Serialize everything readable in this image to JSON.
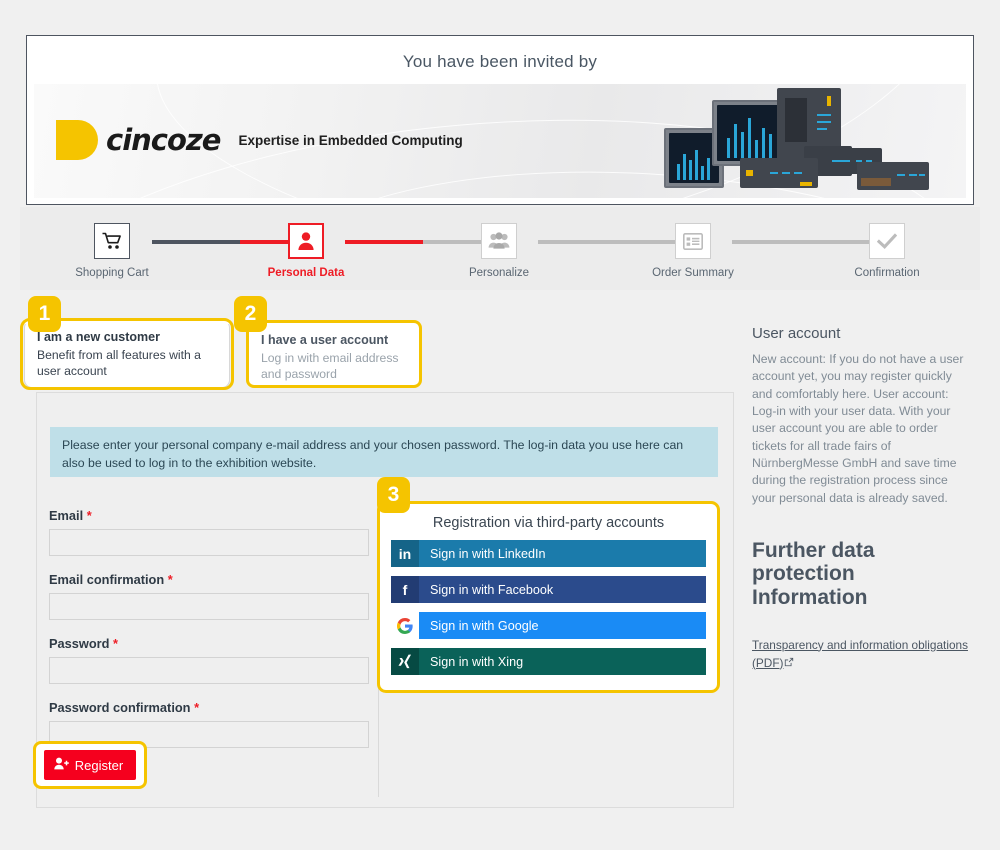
{
  "invited": {
    "title": "You have been invited by",
    "banner": {
      "logo_text": "cincoze",
      "tagline": "Expertise in Embedded Computing",
      "logo_color": "#f5c400"
    }
  },
  "stepper": {
    "steps": [
      {
        "label": "Shopping Cart",
        "icon": "shopping-cart-icon",
        "state": "done"
      },
      {
        "label": "Personal Data",
        "icon": "person-icon",
        "state": "active"
      },
      {
        "label": "Personalize",
        "icon": "people-group-icon",
        "state": "upcoming"
      },
      {
        "label": "Order Summary",
        "icon": "list-document-icon",
        "state": "upcoming"
      },
      {
        "label": "Confirmation",
        "icon": "check-icon",
        "state": "upcoming"
      }
    ],
    "active_color": "#ee1c25",
    "done_color": "#4e5560",
    "upcoming_color": "#c0c0c0"
  },
  "tabs": [
    {
      "badge": "1",
      "title": "I am a new customer",
      "subtitle": "Benefit from all features with a user account",
      "selected": true
    },
    {
      "badge": "2",
      "title": "I have a user account",
      "subtitle": "Log in with email address and password",
      "selected": false
    }
  ],
  "main": {
    "notice": "Please enter your personal company e-mail address and your chosen password. The log-in data you use here can also be used to log in to the exhibition website.",
    "form": {
      "fields": [
        {
          "label": "Email",
          "required": "*",
          "value": "",
          "placeholder": ""
        },
        {
          "label": "Email confirmation",
          "required": "*",
          "value": "",
          "placeholder": ""
        },
        {
          "label": "Password",
          "required": "*",
          "value": "",
          "placeholder": ""
        },
        {
          "label": "Password confirmation",
          "required": "*",
          "value": "",
          "placeholder": ""
        }
      ],
      "register_label": "Register",
      "register_icon": "user-add-icon",
      "register_color": "#f5001e"
    },
    "third_party": {
      "badge": "3",
      "title": "Registration via third-party accounts",
      "buttons": [
        {
          "label": "Sign in with LinkedIn",
          "icon": "linkedin-icon",
          "glyph": "in",
          "color": "#1b7bab"
        },
        {
          "label": "Sign in with Facebook",
          "icon": "facebook-icon",
          "glyph": "f",
          "color": "#2b4b8c"
        },
        {
          "label": "Sign in with Google",
          "icon": "google-icon",
          "glyph": "G",
          "color": "#1a8bf5"
        },
        {
          "label": "Sign in with Xing",
          "icon": "xing-icon",
          "glyph": "X",
          "color": "#0a6259"
        }
      ]
    }
  },
  "sidebar": {
    "heading": "User account",
    "paragraph": "New account: If you do not have a user account yet, you may register quickly and comfortably here.\nUser account: Log-in with your user data. With your user account you are able to order tickets for all trade fairs of NürnbergMesse GmbH and save time during the registration process since your personal data is already saved.",
    "heading2": "Further data protection Information",
    "link": "Transparency and information obligations (PDF)",
    "link_icon": "external-link-icon"
  },
  "colors": {
    "accent_yellow": "#f5c400",
    "red": "#ee1c25",
    "page_bg": "#f0f0f0",
    "notice_bg": "#bfdfe8"
  }
}
